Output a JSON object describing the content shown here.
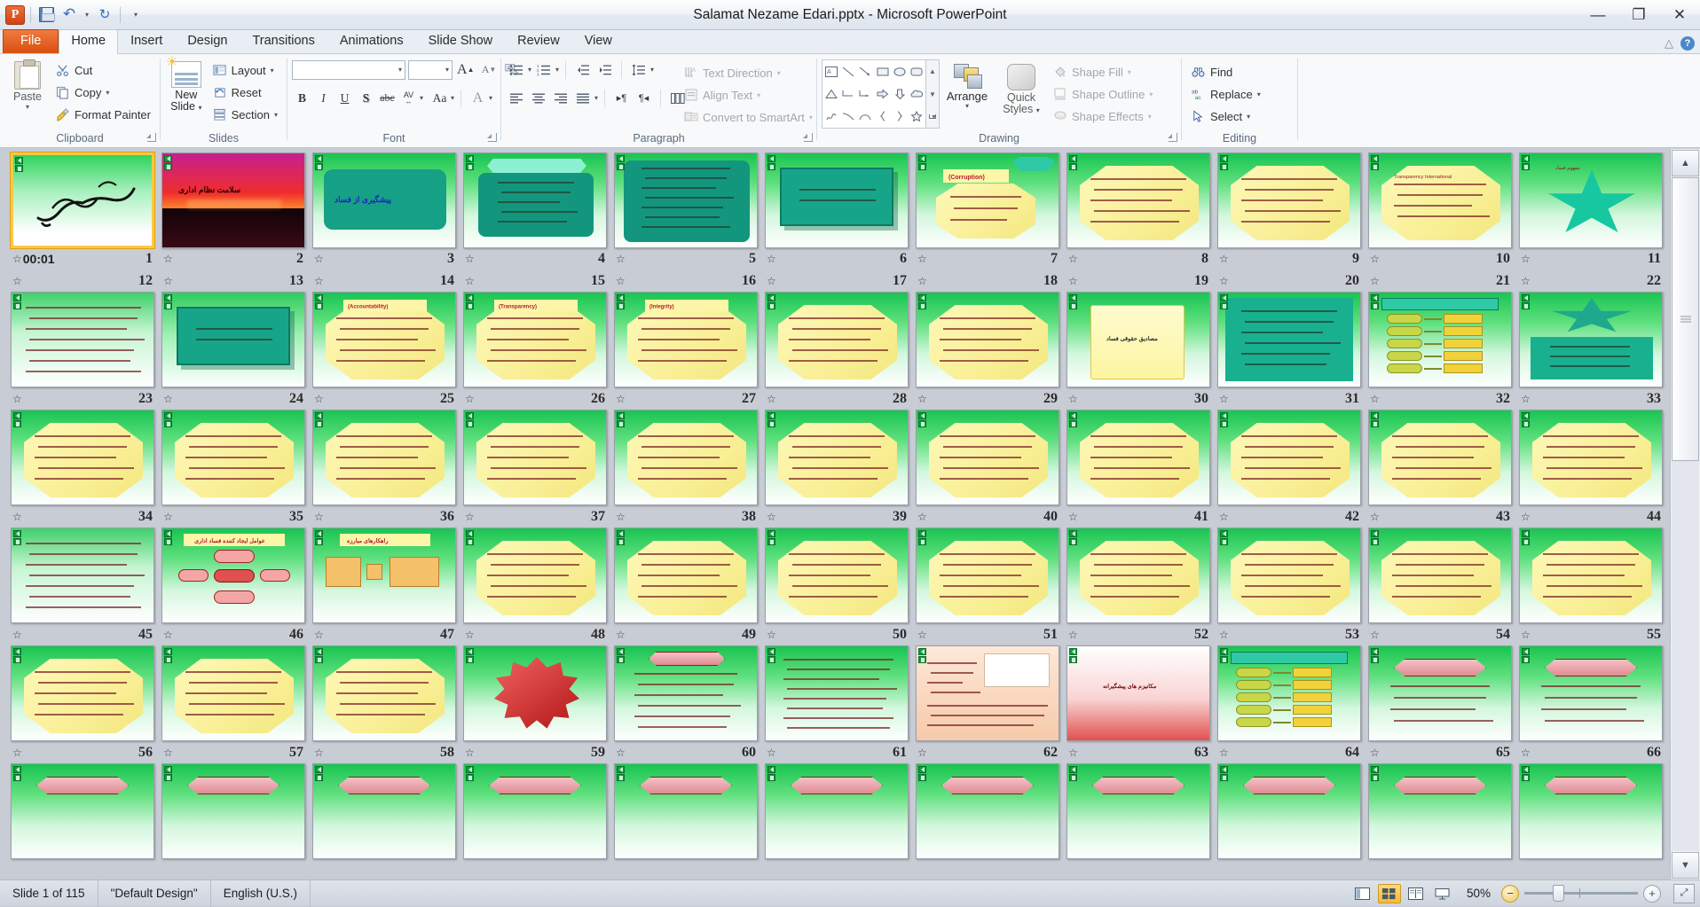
{
  "window": {
    "title": "Salamat Nezame Edari.pptx  -  Microsoft PowerPoint",
    "minimize": "—",
    "restore": "❐",
    "close": "✕"
  },
  "quick_access": {
    "app_logo": "P",
    "save": "save-icon",
    "undo": "↶",
    "undo_caret": "▾",
    "redo": "↻",
    "customize_caret": "▾"
  },
  "tabs": [
    {
      "label": "File",
      "active": false,
      "file": true
    },
    {
      "label": "Home",
      "active": true
    },
    {
      "label": "Insert",
      "active": false
    },
    {
      "label": "Design",
      "active": false
    },
    {
      "label": "Transitions",
      "active": false
    },
    {
      "label": "Animations",
      "active": false
    },
    {
      "label": "Slide Show",
      "active": false
    },
    {
      "label": "Review",
      "active": false
    },
    {
      "label": "View",
      "active": false
    }
  ],
  "tab_right": {
    "minimize_ribbon": "△",
    "help": "?"
  },
  "ribbon": {
    "clipboard": {
      "label": "Clipboard",
      "paste": "Paste",
      "paste_caret": "▾",
      "cut": "Cut",
      "copy": "Copy",
      "copy_caret": "▾",
      "format_painter": "Format Painter"
    },
    "slides": {
      "label": "Slides",
      "new_slide": "New",
      "new_slide2": "Slide",
      "new_slide_caret": "▾",
      "layout": "Layout",
      "reset": "Reset",
      "section": "Section",
      "caret": "▾"
    },
    "font": {
      "label": "Font",
      "font_name": "",
      "font_name_placeholder": "",
      "font_size": "",
      "grow": "A",
      "shrink": "A",
      "clear_formatting": "Aa",
      "bold": "B",
      "italic": "I",
      "underline": "U",
      "shadow": "S",
      "strikethrough": "abc",
      "spacing": "AV",
      "change_case": "Aa",
      "font_color": "A",
      "caret": "▾"
    },
    "paragraph": {
      "label": "Paragraph",
      "bullets": "☰",
      "numbering": "≡",
      "decrease_indent": "⇤",
      "increase_indent": "⇥",
      "line_spacing": "↕",
      "align_left": "≡",
      "align_center": "≡",
      "align_right": "≡",
      "justify": "≡",
      "ltr": "▸¶",
      "rtl": "¶◂",
      "columns": "☰",
      "text_direction": "Text Direction",
      "align_text": "Align Text",
      "convert_smartart": "Convert to SmartArt",
      "caret": "▾"
    },
    "drawing": {
      "label": "Drawing",
      "shapes": [
        "▤",
        "╲",
        "↘",
        "▭",
        "◯",
        "▢",
        "△",
        "⌐",
        "⌙",
        "⇨",
        "⇩",
        "☁",
        "∿",
        "⌒",
        "⌓",
        "{",
        "}",
        "☆"
      ],
      "gallery_up": "▲",
      "gallery_down": "▼",
      "gallery_more": "▾",
      "arrange": "Arrange",
      "quick_styles": "Quick",
      "quick_styles2": "Styles",
      "shape_fill": "Shape Fill",
      "shape_outline": "Shape Outline",
      "shape_effects": "Shape Effects",
      "caret": "▾"
    },
    "editing": {
      "label": "Editing",
      "find": "Find",
      "replace": "Replace",
      "select": "Select",
      "caret": "▾"
    }
  },
  "statusbar": {
    "slide_count": "Slide 1 of 115",
    "theme": "\"Default Design\"",
    "language": "English (U.S.)",
    "zoom_level": "50%",
    "zoom_out": "−",
    "zoom_in": "+",
    "fit_to_window": "⤢",
    "views": [
      {
        "name": "normal-view",
        "glyph": "▥",
        "active": false
      },
      {
        "name": "slide-sorter-view",
        "glyph": "▦",
        "active": true
      },
      {
        "name": "reading-view",
        "glyph": "▤",
        "active": false
      },
      {
        "name": "slide-show-view",
        "glyph": "▭",
        "active": false
      }
    ]
  },
  "scrollbar": {
    "up": "▲",
    "down": "▼"
  },
  "sorter": {
    "selected_slide": 1,
    "rows": [
      [
        {
          "n": 1,
          "bg": "green",
          "style": "calligraphy",
          "timing": "00:01",
          "selected": true
        },
        {
          "n": 2,
          "bg": "sunset",
          "style": "photo"
        },
        {
          "n": 3,
          "bg": "green",
          "style": "rrect-title"
        },
        {
          "n": 4,
          "bg": "green",
          "style": "banner-list"
        },
        {
          "n": 5,
          "bg": "green",
          "style": "rrect-list"
        },
        {
          "n": 6,
          "bg": "green",
          "style": "teal-box"
        },
        {
          "n": 7,
          "bg": "green",
          "style": "oct-corruption"
        },
        {
          "n": 8,
          "bg": "green",
          "style": "oct-text"
        },
        {
          "n": 9,
          "bg": "green",
          "style": "oct-text"
        },
        {
          "n": 10,
          "bg": "green",
          "style": "oct-text-en"
        },
        {
          "n": 11,
          "bg": "green",
          "style": "star"
        }
      ],
      [
        {
          "n": 12,
          "bg": "greenlite",
          "style": "plain-text"
        },
        {
          "n": 13,
          "bg": "greenlite",
          "style": "teal-box"
        },
        {
          "n": 14,
          "bg": "green",
          "style": "oct-acc"
        },
        {
          "n": 15,
          "bg": "green",
          "style": "oct-transparency"
        },
        {
          "n": 16,
          "bg": "green",
          "style": "oct-integrity"
        },
        {
          "n": 17,
          "bg": "green",
          "style": "oct-text"
        },
        {
          "n": 18,
          "bg": "green",
          "style": "oct-text"
        },
        {
          "n": 19,
          "bg": "green",
          "style": "scroll-note"
        },
        {
          "n": 20,
          "bg": "green",
          "style": "teal-list"
        },
        {
          "n": 21,
          "bg": "green",
          "style": "smartart"
        },
        {
          "n": 22,
          "bg": "green",
          "style": "teal-star"
        }
      ],
      [
        {
          "n": 23,
          "bg": "green",
          "style": "oct-text"
        },
        {
          "n": 24,
          "bg": "green",
          "style": "oct-text"
        },
        {
          "n": 25,
          "bg": "green",
          "style": "oct-text"
        },
        {
          "n": 26,
          "bg": "green",
          "style": "oct-text"
        },
        {
          "n": 27,
          "bg": "green",
          "style": "oct-text"
        },
        {
          "n": 28,
          "bg": "green",
          "style": "oct-text"
        },
        {
          "n": 29,
          "bg": "green",
          "style": "oct-text"
        },
        {
          "n": 30,
          "bg": "green",
          "style": "oct-text"
        },
        {
          "n": 31,
          "bg": "green",
          "style": "oct-text"
        },
        {
          "n": 32,
          "bg": "green",
          "style": "oct-text"
        },
        {
          "n": 33,
          "bg": "green",
          "style": "oct-text"
        }
      ],
      [
        {
          "n": 34,
          "bg": "greenlite",
          "style": "plain-text"
        },
        {
          "n": 35,
          "bg": "green",
          "style": "diagram-red"
        },
        {
          "n": 36,
          "bg": "green",
          "style": "flow-orange"
        },
        {
          "n": 37,
          "bg": "green",
          "style": "oct-text"
        },
        {
          "n": 38,
          "bg": "green",
          "style": "oct-text"
        },
        {
          "n": 39,
          "bg": "green",
          "style": "oct-text"
        },
        {
          "n": 40,
          "bg": "green",
          "style": "oct-text"
        },
        {
          "n": 41,
          "bg": "green",
          "style": "oct-text"
        },
        {
          "n": 42,
          "bg": "green",
          "style": "oct-text"
        },
        {
          "n": 43,
          "bg": "green",
          "style": "oct-text"
        },
        {
          "n": 44,
          "bg": "green",
          "style": "oct-text"
        }
      ],
      [
        {
          "n": 45,
          "bg": "green",
          "style": "oct-text"
        },
        {
          "n": 46,
          "bg": "green",
          "style": "oct-text"
        },
        {
          "n": 47,
          "bg": "green",
          "style": "oct-text"
        },
        {
          "n": 48,
          "bg": "green",
          "style": "burst-red"
        },
        {
          "n": 49,
          "bg": "green",
          "style": "ribbon-list"
        },
        {
          "n": 50,
          "bg": "green",
          "style": "plain-list"
        },
        {
          "n": 51,
          "bg": "green",
          "style": "peach-note"
        },
        {
          "n": 52,
          "bg": "green",
          "style": "red-card"
        },
        {
          "n": 53,
          "bg": "green",
          "style": "smartart-green"
        },
        {
          "n": 54,
          "bg": "green",
          "style": "ribbon-red"
        },
        {
          "n": 55,
          "bg": "green",
          "style": "ribbon-red"
        }
      ],
      [
        {
          "n": 56,
          "bg": "green",
          "style": "ribbon-red",
          "partial": true
        },
        {
          "n": 57,
          "bg": "green",
          "style": "ribbon-red",
          "partial": true
        },
        {
          "n": 58,
          "bg": "green",
          "style": "ribbon-red",
          "partial": true
        },
        {
          "n": 59,
          "bg": "green",
          "style": "ribbon-red",
          "partial": true
        },
        {
          "n": 60,
          "bg": "green",
          "style": "ribbon-red",
          "partial": true
        },
        {
          "n": 61,
          "bg": "green",
          "style": "ribbon-red",
          "partial": true
        },
        {
          "n": 62,
          "bg": "green",
          "style": "ribbon-red",
          "partial": true
        },
        {
          "n": 63,
          "bg": "green",
          "style": "ribbon-red",
          "partial": true
        },
        {
          "n": 64,
          "bg": "green",
          "style": "ribbon-red",
          "partial": true
        },
        {
          "n": 65,
          "bg": "green",
          "style": "ribbon-red",
          "partial": true
        },
        {
          "n": 66,
          "bg": "green",
          "style": "ribbon-red",
          "partial": true
        }
      ]
    ]
  },
  "icons": {
    "anim_star": "☆",
    "transition_star": "★"
  },
  "colors": {
    "accent_orange": "#d94f10",
    "selection_gold": "#ffc843",
    "workspace": "#c8ccd4",
    "ribbon_bg": "#f7f9fb"
  }
}
